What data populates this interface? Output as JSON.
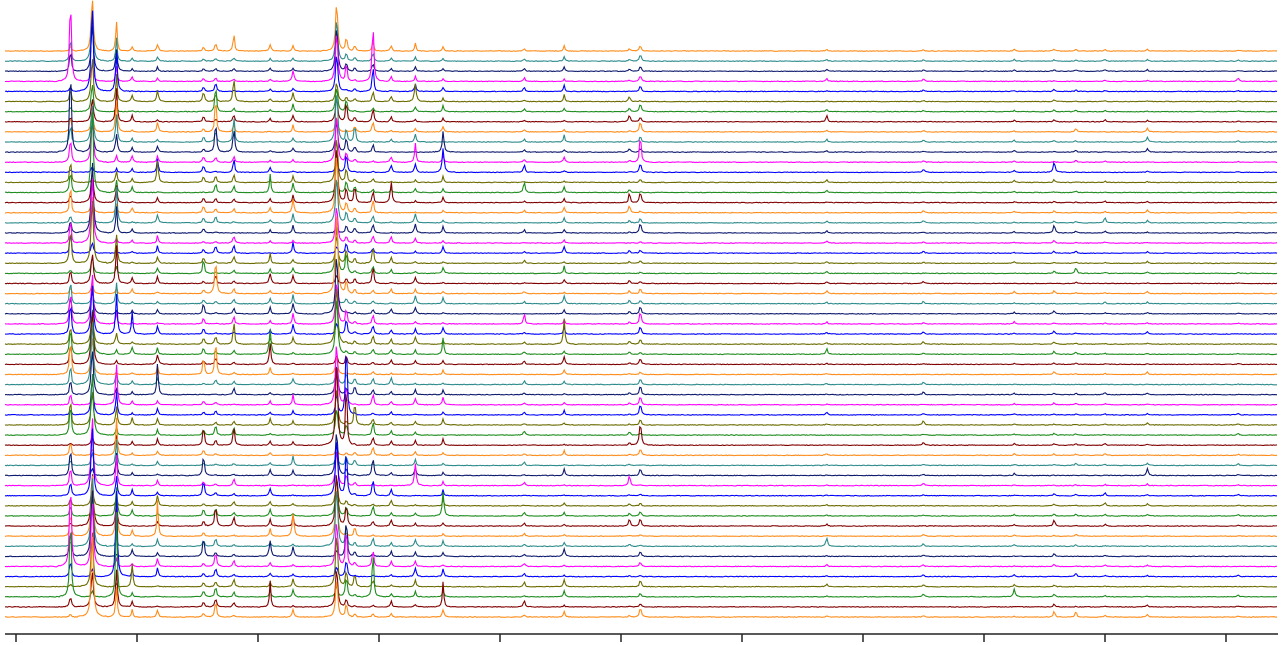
{
  "chart_data": {
    "type": "line",
    "title": "",
    "xlabel": "",
    "ylabel": "",
    "grid": false,
    "legend": "none",
    "xlim": [
      0,
      10.5
    ],
    "x_ticks": [
      0,
      1,
      2,
      3,
      4,
      5,
      6,
      7,
      8,
      9,
      10
    ],
    "x_tick_labels": [],
    "stacked_offset": true,
    "n_series": 57,
    "palette": [
      "#ff8c1a",
      "#2e8b8b",
      "#0d1a6e",
      "#ff00ff",
      "#0000ff",
      "#6b6b00",
      "#1e8c1e",
      "#800000"
    ],
    "peak_positions": [
      0.45,
      0.63,
      0.83,
      0.96,
      1.17,
      1.55,
      1.65,
      1.8,
      2.1,
      2.29,
      2.65,
      2.73,
      2.8,
      2.95,
      3.1,
      3.3,
      3.53,
      4.2,
      4.53,
      5.07,
      5.16,
      6.7,
      7.5,
      8.25,
      8.58,
      8.76,
      9.0,
      9.35,
      10.1
    ],
    "common_profile": [
      0.5,
      1.0,
      0.55,
      0.1,
      0.15,
      0.1,
      0.15,
      0.12,
      0.1,
      0.15,
      0.9,
      0.3,
      0.1,
      0.25,
      0.1,
      0.12,
      0.1,
      0.06,
      0.1,
      0.05,
      0.15,
      0.04,
      0.04,
      0.03,
      0.04,
      0.03,
      0.03,
      0.03,
      0.02
    ],
    "series_peaks": [
      [
        0.1,
        1.0,
        0.55,
        0.08,
        0.12,
        0.08,
        0.15,
        0.35,
        0.12,
        0.1,
        0.9,
        0.25,
        0.1,
        0.2,
        0.1,
        0.15,
        0.08,
        0.05,
        0.1,
        0.04,
        0.1,
        0.03,
        0.03,
        0.03,
        0.03,
        0.03,
        0.03,
        0.03,
        0.02
      ],
      [
        0.5,
        1.0,
        0.45,
        0.05,
        0.08,
        0.05,
        0.06,
        0.06,
        0.05,
        0.06,
        0.8,
        0.15,
        0.08,
        0.15,
        0.06,
        0.08,
        0.05,
        0.05,
        0.08,
        0.04,
        0.12,
        0.03,
        0.03,
        0.03,
        0.03,
        0.03,
        0.03,
        0.03,
        0.02
      ],
      [
        0.4,
        0.9,
        0.4,
        0.05,
        0.08,
        0.05,
        0.05,
        0.05,
        0.05,
        0.05,
        0.85,
        0.15,
        0.08,
        0.15,
        0.06,
        0.08,
        0.05,
        0.05,
        0.08,
        0.04,
        0.12,
        0.03,
        0.03,
        0.03,
        0.03,
        0.03,
        0.03,
        0.03,
        0.02
      ]
    ]
  }
}
